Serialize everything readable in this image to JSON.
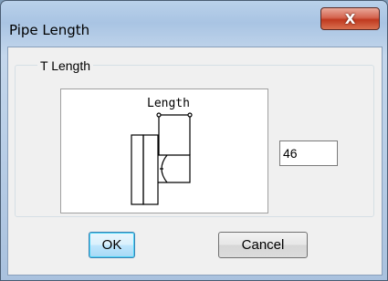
{
  "window": {
    "title": "Pipe Length",
    "close_glyph": "X"
  },
  "group": {
    "label": "T Length"
  },
  "diagram": {
    "label": "Length"
  },
  "length_input": {
    "value": "46"
  },
  "buttons": {
    "ok_label": "OK",
    "cancel_label": "Cancel"
  }
}
